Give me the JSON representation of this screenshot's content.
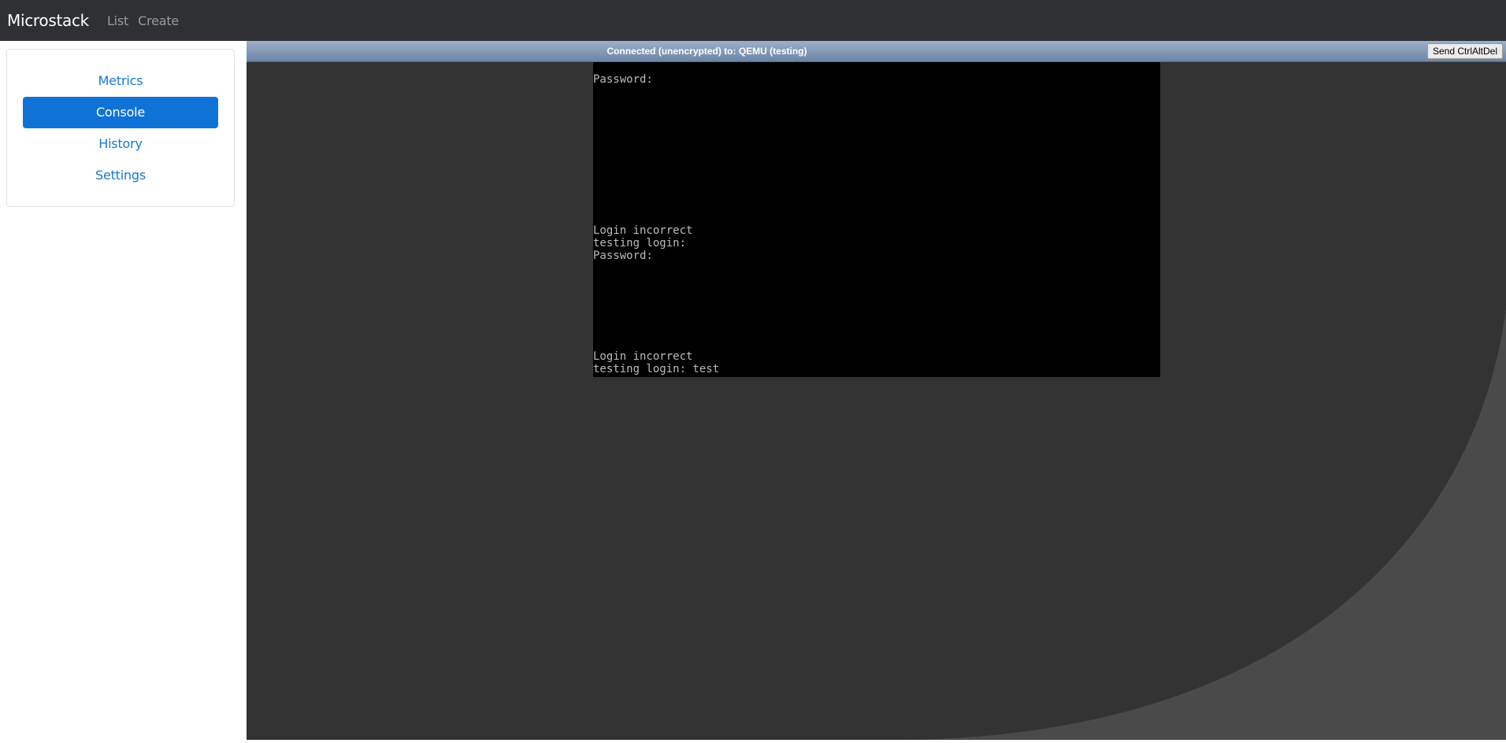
{
  "navbar": {
    "brand": "Microstack",
    "links": [
      "List",
      "Create"
    ]
  },
  "sidebar": {
    "items": [
      {
        "label": "Metrics",
        "active": false
      },
      {
        "label": "Console",
        "active": true
      },
      {
        "label": "History",
        "active": false
      },
      {
        "label": "Settings",
        "active": false
      }
    ]
  },
  "vnc": {
    "status": "Connected (unencrypted) to: QEMU (testing)",
    "ctrl_alt_del_label": "Send CtrlAltDel",
    "terminal_lines": [
      "Password:",
      "Login incorrect",
      "testing login:",
      "Password:",
      "Login incorrect",
      "testing login: test"
    ]
  },
  "colors": {
    "navbar_bg": "#2f3034",
    "accent": "#0f72d6",
    "vnc_bg": "#333333",
    "terminal_bg": "#000000"
  }
}
